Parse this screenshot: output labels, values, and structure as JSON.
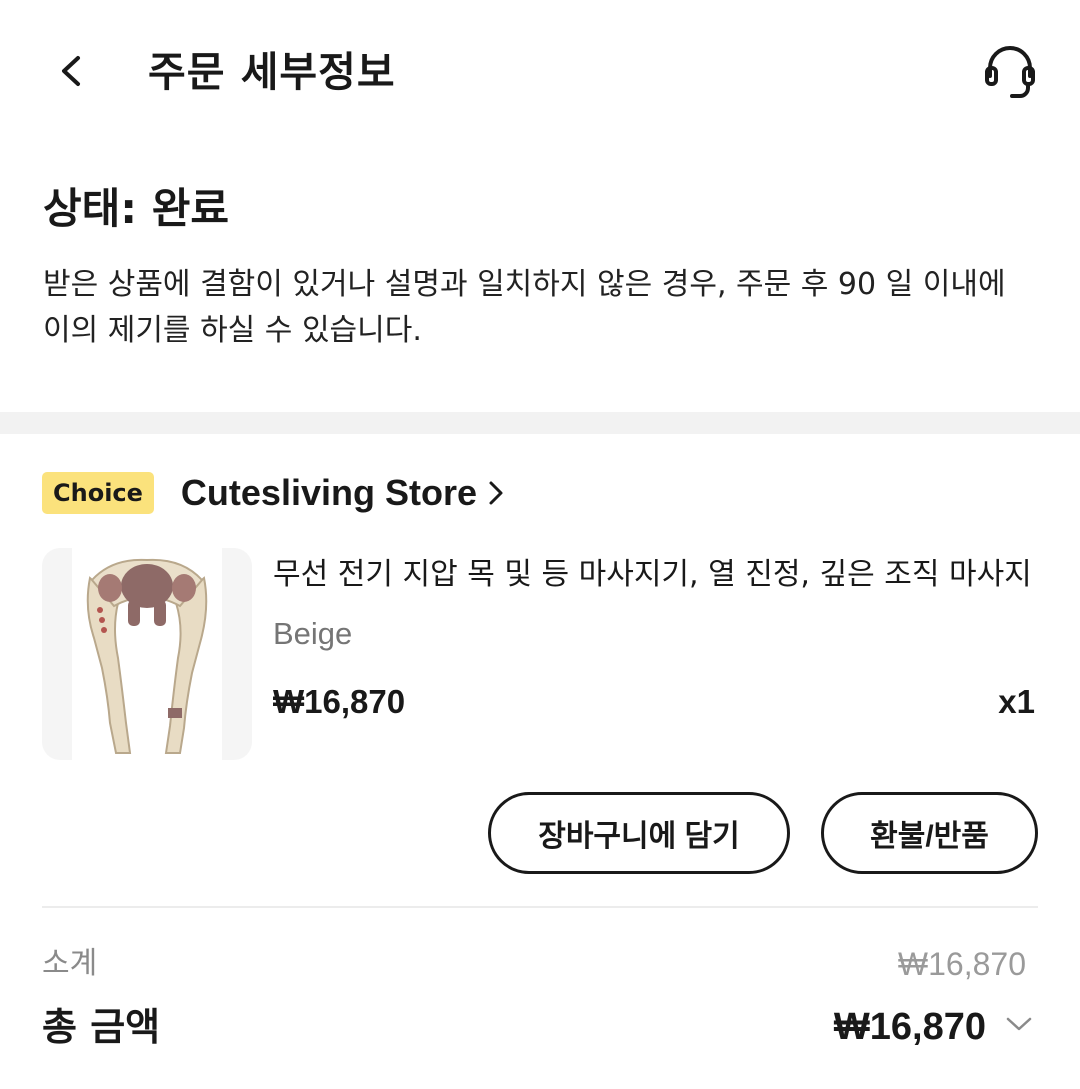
{
  "header": {
    "title": "주문 세부정보",
    "back_icon": "chevron-left-icon",
    "support_icon": "headset-icon"
  },
  "status": {
    "title": "상태: 완료",
    "description": "받은 상품에 결함이 있거나 설명과 일치하지 않은 경우, 주문 후 90 일 이내에 이의 제기를 하실 수 있습니다."
  },
  "store": {
    "badge": "Choice",
    "name": "Cutesliving Store",
    "badge_color": "#fbe27c"
  },
  "product": {
    "name": "무선 전기 지압 목 및 등 마사지기, 열 진정, 깊은 조직 마사지",
    "variant": "Beige",
    "price": "₩16,870",
    "quantity": "x1"
  },
  "actions": {
    "add_to_cart": "장바구니에 담기",
    "refund_return": "환불/반품"
  },
  "summary": {
    "subtotal_label": "소계",
    "subtotal_value": "₩16,870",
    "total_label": "총 금액",
    "total_value": "₩16,870"
  }
}
